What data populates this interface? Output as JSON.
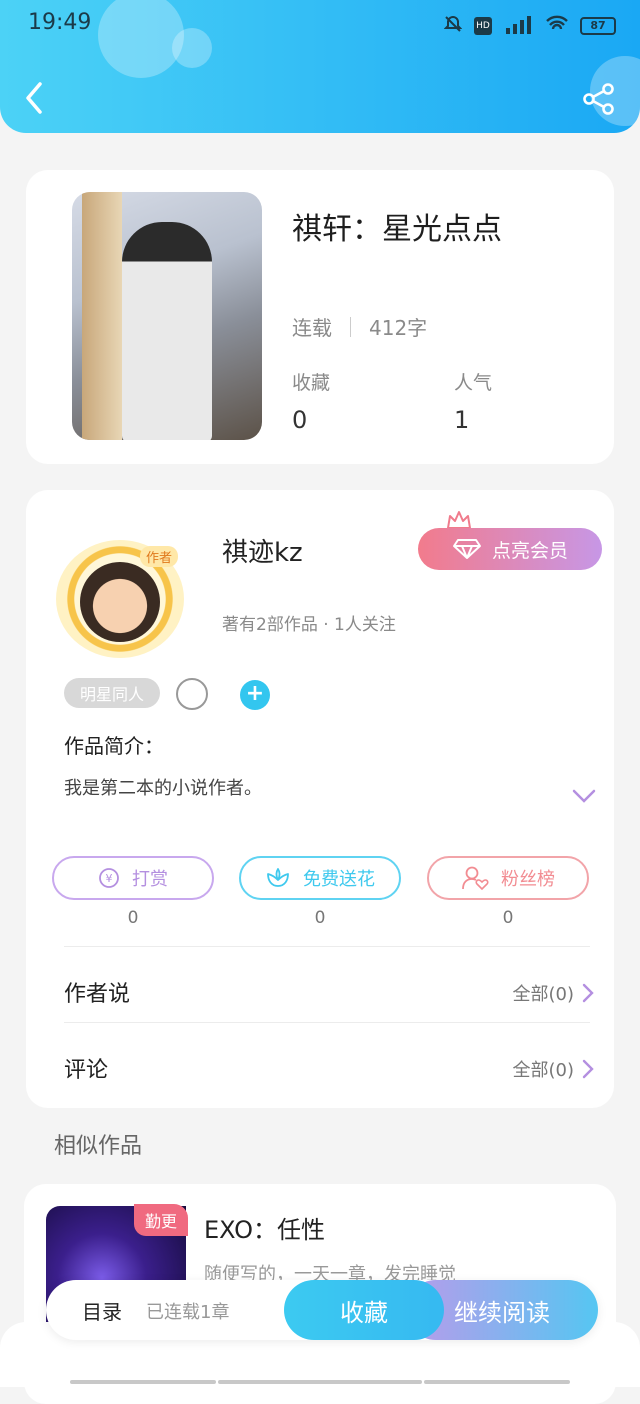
{
  "status_bar": {
    "time": "19:49",
    "battery": "87"
  },
  "book": {
    "title": "祺轩：星光点点",
    "status": "连载",
    "words": "412字",
    "fav_label": "收藏",
    "fav_count": "0",
    "pop_label": "人气",
    "pop_count": "1"
  },
  "author": {
    "avatar_tag": "作者",
    "name": "祺迹kz",
    "vip_label": "点亮会员",
    "meta": "著有2部作品 · 1人关注",
    "tag": "明星同人",
    "intro_heading": "作品简介：",
    "intro": "我是第二本的小说作者。"
  },
  "actions": [
    {
      "label": "打赏",
      "count": "0",
      "color": "#b48fe0"
    },
    {
      "label": "免费送花",
      "count": "0",
      "color": "#3fc9ee"
    },
    {
      "label": "粉丝榜",
      "count": "0",
      "color": "#f28c92"
    }
  ],
  "rows": {
    "author_says": {
      "label": "作者说",
      "value": "全部(0)"
    },
    "comments": {
      "label": "评论",
      "value": "全部(0)"
    }
  },
  "similar": {
    "heading": "相似作品",
    "item": {
      "badge": "勤更",
      "title": "EXO：任性",
      "desc": "随便写的，一天一章，发完睡觉"
    }
  },
  "bottom_bar": {
    "toc": "目录",
    "toc_sub": "已连载1章",
    "favorite": "收藏",
    "continue": "继续阅读"
  }
}
